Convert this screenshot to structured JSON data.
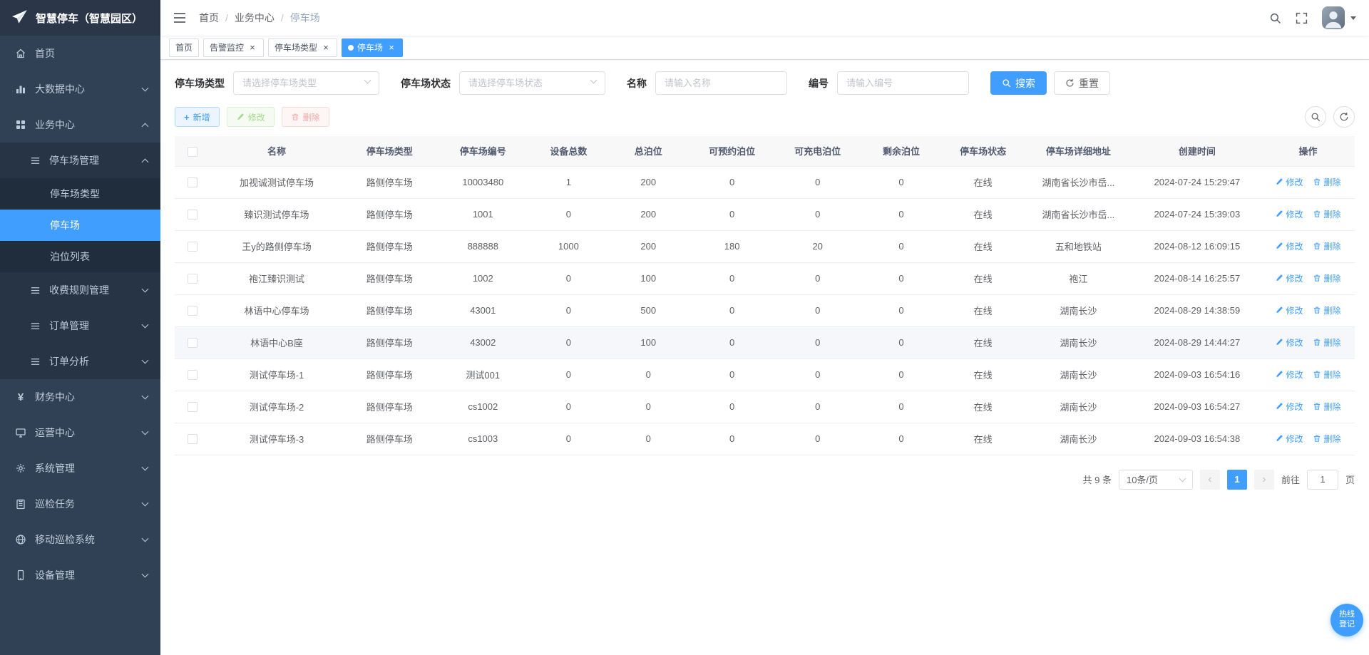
{
  "app": {
    "title": "智慧停车（智慧园区）"
  },
  "sidebar": {
    "items": [
      {
        "label": "首页"
      },
      {
        "label": "大数据中心"
      },
      {
        "label": "业务中心",
        "children": [
          {
            "label": "停车场管理",
            "children": [
              {
                "label": "停车场类型"
              },
              {
                "label": "停车场",
                "active": true
              },
              {
                "label": "泊位列表"
              }
            ]
          },
          {
            "label": "收费规则管理"
          },
          {
            "label": "订单管理"
          },
          {
            "label": "订单分析"
          }
        ]
      },
      {
        "label": "财务中心"
      },
      {
        "label": "运营中心"
      },
      {
        "label": "系统管理"
      },
      {
        "label": "巡检任务"
      },
      {
        "label": "移动巡检系统"
      },
      {
        "label": "设备管理"
      }
    ]
  },
  "breadcrumb": [
    "首页",
    "业务中心",
    "停车场"
  ],
  "breadcrumb_separator": "/",
  "tags": [
    {
      "label": "首页",
      "closable": false,
      "active": false
    },
    {
      "label": "告警监控",
      "closable": true,
      "active": false
    },
    {
      "label": "停车场类型",
      "closable": true,
      "active": false
    },
    {
      "label": "停车场",
      "closable": true,
      "active": true
    }
  ],
  "filters": {
    "type_label": "停车场类型",
    "type_placeholder": "请选择停车场类型",
    "status_label": "停车场状态",
    "status_placeholder": "请选择停车场状态",
    "name_label": "名称",
    "name_placeholder": "请输入名称",
    "code_label": "编号",
    "code_placeholder": "请输入编号",
    "search_label": "搜索",
    "reset_label": "重置"
  },
  "toolbar": {
    "add": "新增",
    "edit": "修改",
    "delete": "删除"
  },
  "table": {
    "columns": [
      "名称",
      "停车场类型",
      "停车场编号",
      "设备总数",
      "总泊位",
      "可预约泊位",
      "可充电泊位",
      "剩余泊位",
      "停车场状态",
      "停车场详细地址",
      "创建时间",
      "操作"
    ],
    "rows": [
      [
        "加视诚测试停车场",
        "路侧停车场",
        "10003480",
        "1",
        "200",
        "0",
        "0",
        "0",
        "在线",
        "湖南省长沙市岳...",
        "2024-07-24 15:29:47"
      ],
      [
        "臻识测试停车场",
        "路侧停车场",
        "1001",
        "0",
        "200",
        "0",
        "0",
        "0",
        "在线",
        "湖南省长沙市岳...",
        "2024-07-24 15:39:03"
      ],
      [
        "王y的路侧停车场",
        "路侧停车场",
        "888888",
        "1000",
        "200",
        "180",
        "20",
        "0",
        "在线",
        "五和地铁站",
        "2024-08-12 16:09:15"
      ],
      [
        "袍江臻识测试",
        "路侧停车场",
        "1002",
        "0",
        "100",
        "0",
        "0",
        "0",
        "在线",
        "袍江",
        "2024-08-14 16:25:57"
      ],
      [
        "林语中心停车场",
        "路侧停车场",
        "43001",
        "0",
        "500",
        "0",
        "0",
        "0",
        "在线",
        "湖南长沙",
        "2024-08-29 14:38:59"
      ],
      [
        "林语中心B座",
        "路侧停车场",
        "43002",
        "0",
        "100",
        "0",
        "0",
        "0",
        "在线",
        "湖南长沙",
        "2024-08-29 14:44:27"
      ],
      [
        "测试停车场-1",
        "路侧停车场",
        "测试001",
        "0",
        "0",
        "0",
        "0",
        "0",
        "在线",
        "湖南长沙",
        "2024-09-03 16:54:16"
      ],
      [
        "测试停车场-2",
        "路侧停车场",
        "cs1002",
        "0",
        "0",
        "0",
        "0",
        "0",
        "在线",
        "湖南长沙",
        "2024-09-03 16:54:27"
      ],
      [
        "测试停车场-3",
        "路侧停车场",
        "cs1003",
        "0",
        "0",
        "0",
        "0",
        "0",
        "在线",
        "湖南长沙",
        "2024-09-03 16:54:38"
      ]
    ],
    "actions": {
      "edit": "修改",
      "delete": "删除"
    }
  },
  "pagination": {
    "total": "共 9 条",
    "page_size": "10条/页",
    "prev_glyph": "‹",
    "current_page": "1",
    "next_glyph": "›",
    "goto_label": "前往",
    "goto_value": "1",
    "page_unit": "页"
  },
  "float_button": {
    "line1": "热线",
    "line2": "登记"
  },
  "icons": {
    "finance_glyph": "¥",
    "close_glyph": "×",
    "plus_glyph": "+"
  },
  "colors": {
    "primary": "#409EFF",
    "success": "#67c23a",
    "danger": "#f56c6c",
    "sidebar_bg": "#304156",
    "submenu_bg": "#1f2d3d",
    "active_row_bg": "#f5f7fa"
  }
}
